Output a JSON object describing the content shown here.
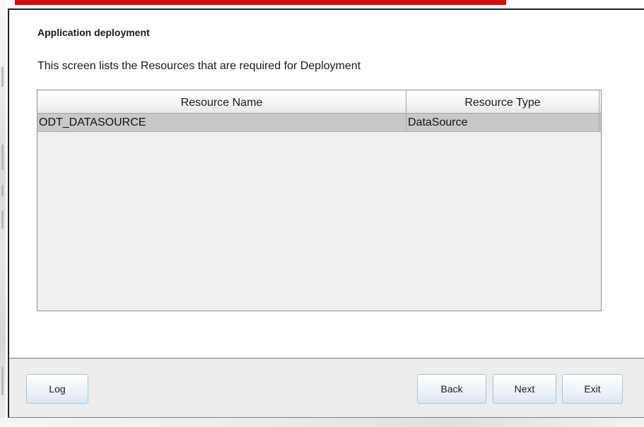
{
  "wizard": {
    "title": "Application deployment",
    "description": "This screen lists the Resources that are required for Deployment"
  },
  "resources_table": {
    "columns": [
      "Resource Name",
      "Resource Type"
    ],
    "rows": [
      [
        "ODT_DATASOURCE",
        "DataSource"
      ]
    ]
  },
  "buttons": {
    "log": "Log",
    "back": "Back",
    "next": "Next",
    "exit": "Exit"
  },
  "colors": {
    "accent_bar": "#cc1111",
    "selected_row": "#c8c8c8",
    "button_border": "#9fc6e0"
  }
}
